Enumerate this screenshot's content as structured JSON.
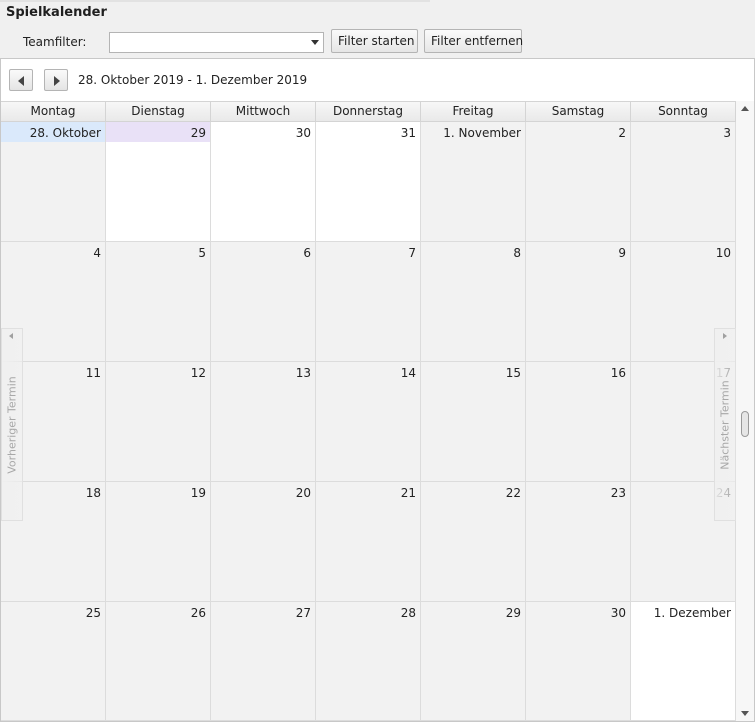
{
  "window": {
    "title": "Spielkalender"
  },
  "filter": {
    "label": "Teamfilter:",
    "value": "",
    "start_button": "Filter starten",
    "remove_button": "Filter entfernen"
  },
  "calendar": {
    "range": "28. Oktober 2019 - 1. Dezember 2019",
    "day_headers": [
      "Montag",
      "Dienstag",
      "Mittwoch",
      "Donnerstag",
      "Freitag",
      "Samstag",
      "Sonntag"
    ],
    "weeks": [
      [
        "28. Oktober",
        "29",
        "30",
        "31",
        "1. November",
        "2",
        "3"
      ],
      [
        "4",
        "5",
        "6",
        "7",
        "8",
        "9",
        "10"
      ],
      [
        "11",
        "12",
        "13",
        "14",
        "15",
        "16",
        "17"
      ],
      [
        "18",
        "19",
        "20",
        "21",
        "22",
        "23",
        "24"
      ],
      [
        "25",
        "26",
        "27",
        "28",
        "29",
        "30",
        "1. Dezember"
      ]
    ],
    "prev_appointment": "Vorheriger Termin",
    "next_appointment": "Nächster Termin"
  }
}
